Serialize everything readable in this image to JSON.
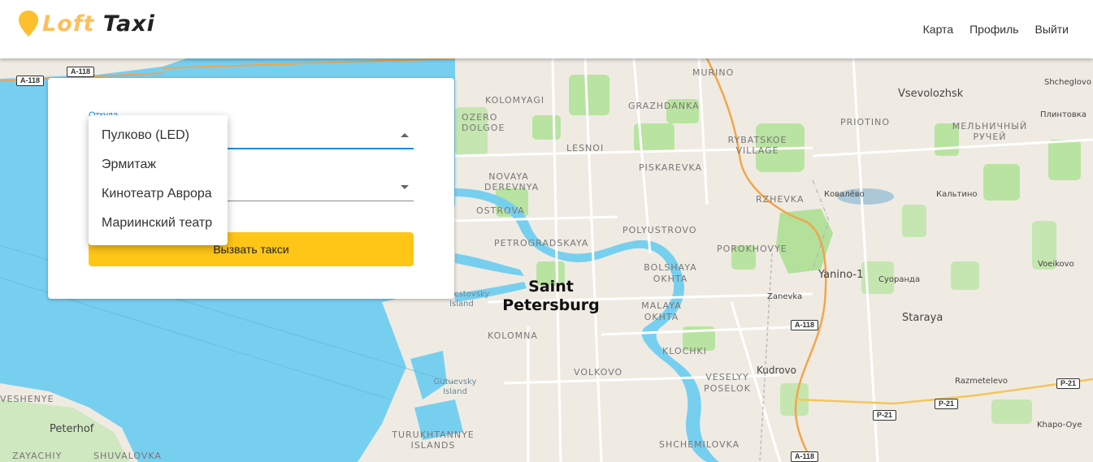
{
  "header": {
    "logo_loft": "Loft",
    "logo_taxi": "Taxi",
    "nav": [
      {
        "label": "Карта"
      },
      {
        "label": "Профиль"
      },
      {
        "label": "Выйти"
      }
    ]
  },
  "form": {
    "from_label": "Откуда",
    "call_button": "Вызвать такси"
  },
  "dropdown": {
    "options": [
      {
        "label": "Пулково (LED)"
      },
      {
        "label": "Эрмитаж"
      },
      {
        "label": "Кинотеатр Аврора"
      },
      {
        "label": "Мариинский театр"
      }
    ]
  },
  "map": {
    "city": "Saint Petersburg",
    "districts": [
      "MURINO",
      "KOLOMYAGI",
      "GRAZHDANKA",
      "OZERO DOLGOE",
      "LESNOI",
      "RYBATSKOE VILLAGE",
      "PRIOTINO",
      "МЕЛЬНИЧНЫЙ РУЧЕЙ",
      "NOVAYA DEREVNYA",
      "PISKAREVKA",
      "RZHEVKA",
      "OSTROVA",
      "PETROGRADSKAYA",
      "POLYUSTROVO",
      "POROKHOVYE",
      "BOLSHAYA OKHTA",
      "MALAYA OKHTA",
      "KOLOMNA",
      "KLOCHKI",
      "VOLKOVO",
      "VESELYY POSELOK",
      "SHCHEMILOVKA",
      "TURUKHTANNYE ISLANDS",
      "VESHENYE",
      "ZAYACHIY",
      "SHUVALOVKA"
    ],
    "towns": [
      "Vsevolozhsk",
      "Shcheglovo",
      "Плинтовка",
      "Ковалёво",
      "Кальтино",
      "Yanino-1",
      "Суоранда",
      "Voeikovo",
      "Zanevka",
      "Staraya",
      "Kudrovo",
      "Razmetelevo",
      "Khapo-Oye",
      "Peterhof"
    ],
    "islands": [
      "Krestovsky Island",
      "Gutuevsky Island"
    ],
    "roads": [
      "A-118",
      "P-21"
    ]
  }
}
